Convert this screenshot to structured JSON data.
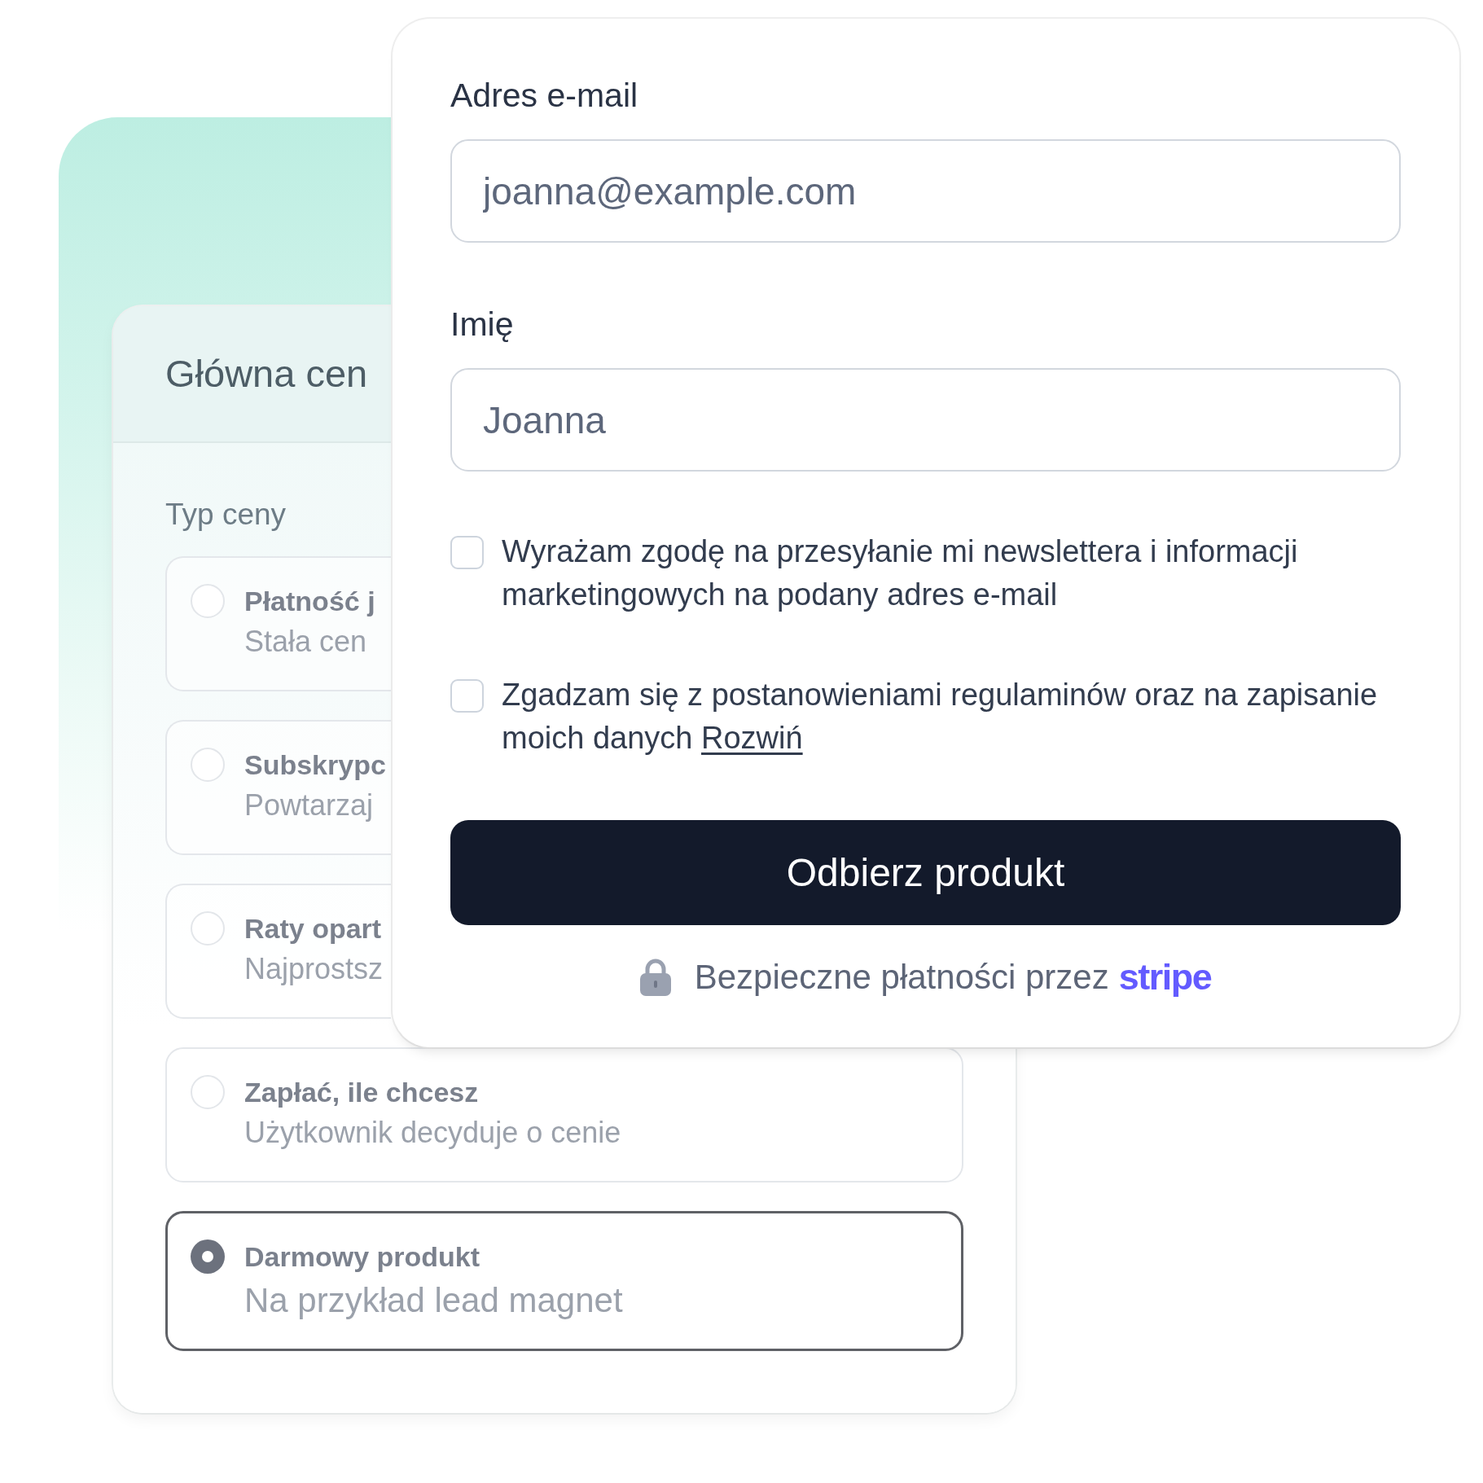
{
  "pricing_panel": {
    "title": "Główna cen",
    "section_label": "Typ ceny",
    "options": [
      {
        "title": "Płatność j",
        "subtitle": "Stała cen",
        "selected": false
      },
      {
        "title": "Subskrypc",
        "subtitle": "Powtarzaj",
        "selected": false
      },
      {
        "title": "Raty opart",
        "subtitle": "Najprostsz",
        "selected": false
      },
      {
        "title": "Zapłać, ile chcesz",
        "subtitle": "Użytkownik decyduje o cenie",
        "selected": false
      },
      {
        "title": "Darmowy produkt",
        "subtitle": "Na przykład lead magnet",
        "selected": true
      }
    ]
  },
  "signup_form": {
    "fields": [
      {
        "label": "Adres e-mail",
        "placeholder": "joanna@example.com"
      },
      {
        "label": "Imię",
        "placeholder": "Joanna"
      }
    ],
    "consents": [
      {
        "text": "Wyrażam zgodę na przesyłanie mi newslettera i informacji marketingowych na podany adres e-mail",
        "checked": false
      },
      {
        "text": "Zgadzam się z postanowieniami regulaminów oraz na zapisanie moich danych",
        "link": "Rozwiń",
        "checked": false
      }
    ],
    "submit_button": "Odbierz produkt",
    "footer": {
      "text": "Bezpieczne płatności przez",
      "provider": "stripe"
    }
  }
}
